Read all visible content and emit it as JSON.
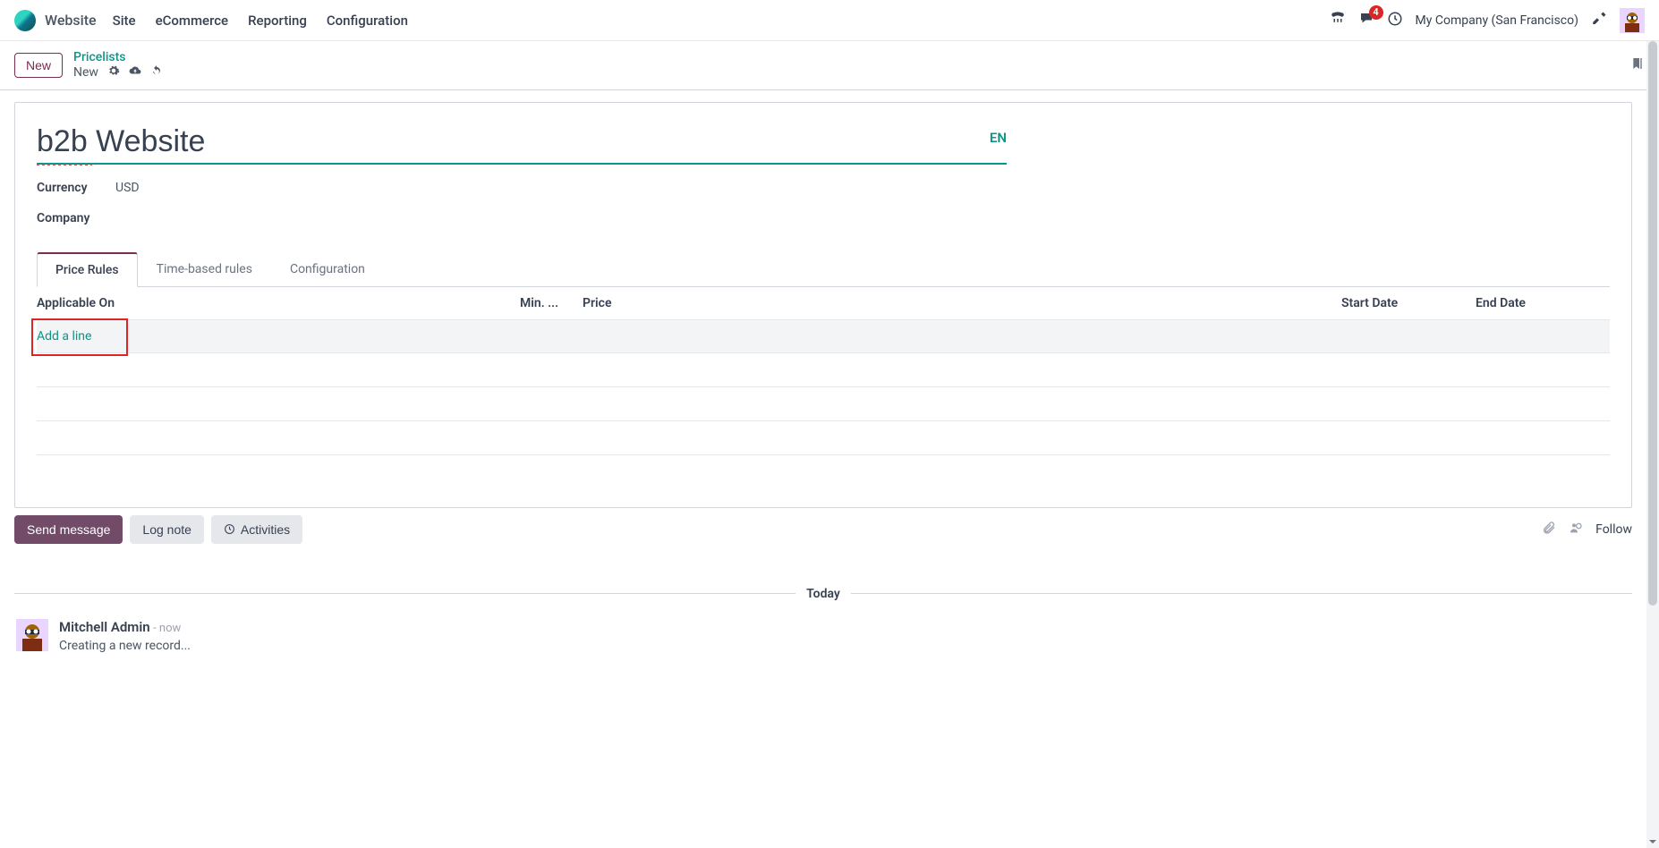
{
  "nav": {
    "brand": "Website",
    "items": [
      "Site",
      "eCommerce",
      "Reporting",
      "Configuration"
    ],
    "notification_count": "4",
    "company": "My Company (San Francisco)"
  },
  "actionbar": {
    "new_button": "New",
    "breadcrumb_parent": "Pricelists",
    "breadcrumb_current": "New"
  },
  "form": {
    "title": "b2b Website",
    "lang_badge": "EN",
    "currency_label": "Currency",
    "currency_value": "USD",
    "company_label": "Company"
  },
  "tabs": [
    "Price Rules",
    "Time-based rules",
    "Configuration"
  ],
  "table": {
    "columns": [
      "Applicable On",
      "Min. ...",
      "Price",
      "Start Date",
      "End Date"
    ],
    "add_line": "Add a line"
  },
  "chatter": {
    "send_message": "Send message",
    "log_note": "Log note",
    "activities": "Activities",
    "follow": "Follow",
    "separator": "Today",
    "message": {
      "author": "Mitchell Admin",
      "time": "- now",
      "text": "Creating a new record..."
    }
  }
}
